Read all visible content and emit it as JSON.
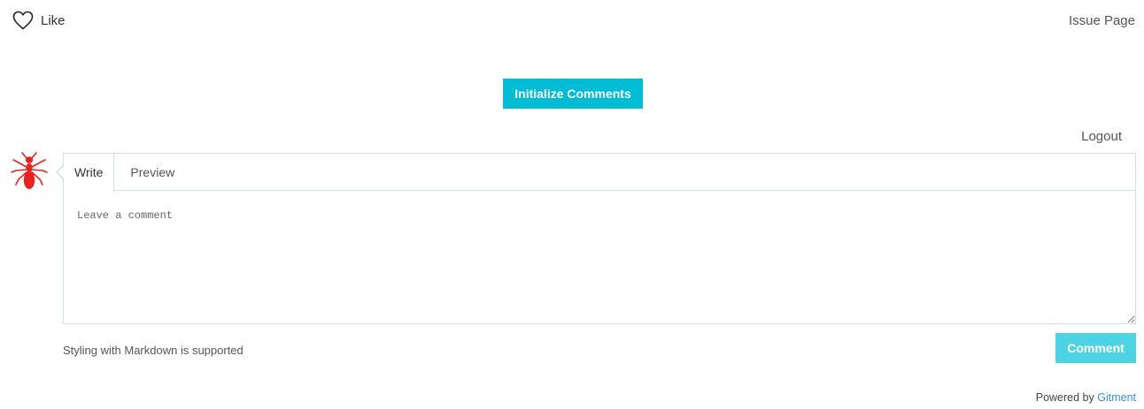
{
  "header": {
    "like_label": "Like",
    "issue_page_label": "Issue Page"
  },
  "init": {
    "button_label": "Initialize Comments"
  },
  "account": {
    "logout_label": "Logout"
  },
  "editor": {
    "tabs": [
      {
        "label": "Write",
        "active": true
      },
      {
        "label": "Preview",
        "active": false
      }
    ],
    "placeholder": "Leave a comment",
    "value": ""
  },
  "footer": {
    "markdown_note": "Styling with Markdown is supported",
    "comment_button_label": "Comment",
    "powered_prefix": "Powered by",
    "powered_link": "Gitment"
  },
  "icons": {
    "like": "heart-outline-icon",
    "avatar": "red-ant-avatar"
  },
  "colors": {
    "accent": "#00bcd4",
    "accent_disabled": "#4dd3e3",
    "link": "#3a8fd8",
    "avatar_red": "#e8231f",
    "border": "#cfe0e3"
  }
}
